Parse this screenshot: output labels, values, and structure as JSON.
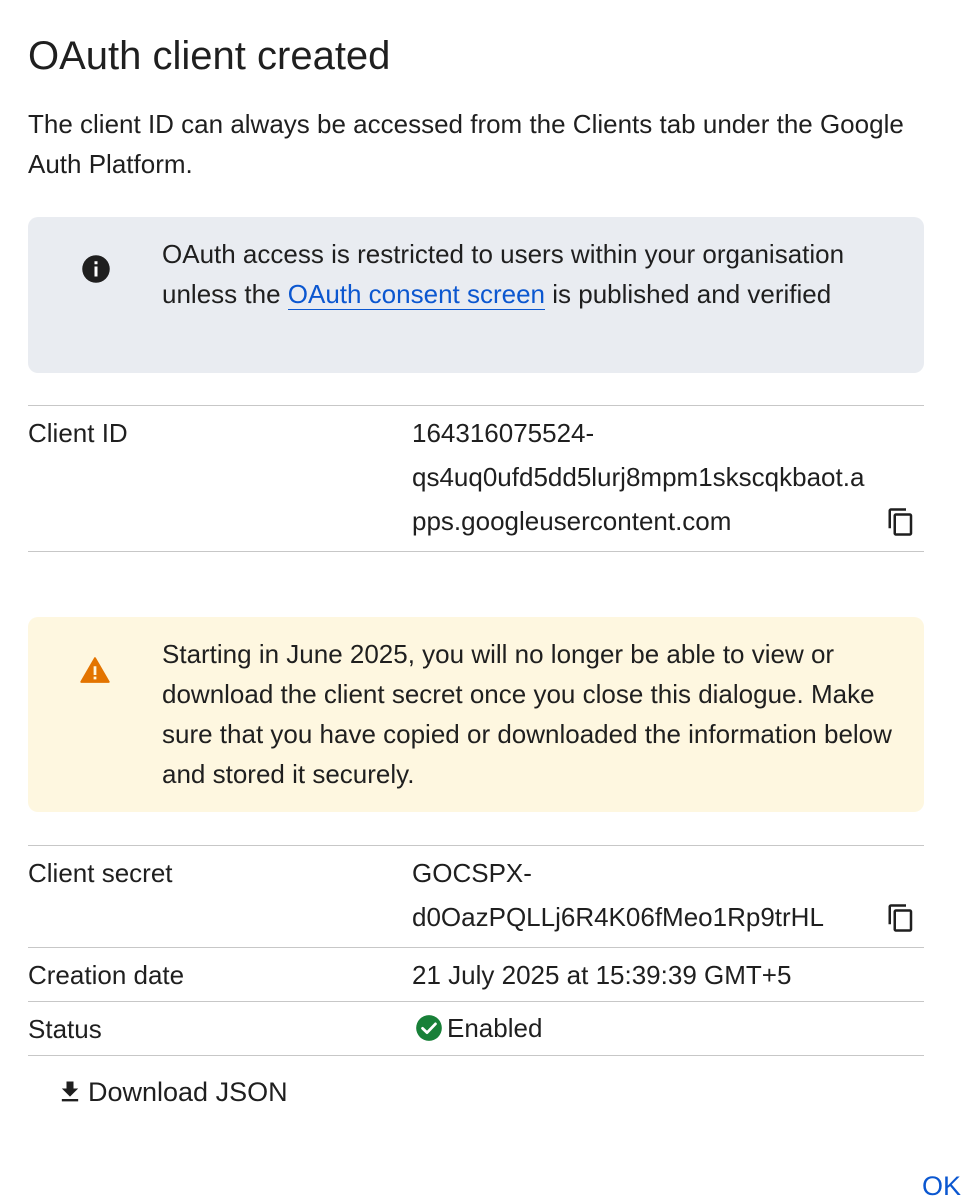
{
  "dialog": {
    "title": "OAuth client created",
    "description": "The client ID can always be accessed from the Clients tab under the Google Auth Platform."
  },
  "info_callout": {
    "icon": "info-icon",
    "text_before": "OAuth access is restricted to users within your organisation unless the ",
    "link_text": "OAuth consent screen",
    "text_after": " is published and verified"
  },
  "client_id": {
    "label": "Client ID",
    "value": "164316075524-qs4uq0ufd5dd5lurj8mpm1skscqkbaot.apps.googleusercontent.com",
    "value_lines": [
      "164316075524-",
      "qs4uq0ufd5dd5lurj8mpm1skscqkbaot.a",
      "pps.googleusercontent.com"
    ]
  },
  "warning_callout": {
    "icon": "warning-icon",
    "text": "Starting in June 2025, you will no longer be able to view or download the client secret once you close this dialogue. Make sure that you have copied or downloaded the information below and stored it securely."
  },
  "client_secret": {
    "label": "Client secret",
    "value_lines": [
      "GOCSPX-",
      "d0OazPQLLj6R4K06fMeo1Rp9trHL"
    ]
  },
  "creation_date": {
    "label": "Creation date",
    "value": "21 July 2025 at 15:39:39 GMT+5"
  },
  "status": {
    "label": "Status",
    "value": "Enabled",
    "icon": "check-circle-icon"
  },
  "actions": {
    "download_label": "Download JSON",
    "ok_label": "OK"
  },
  "colors": {
    "accent": "#0b57d0",
    "info_bg": "#e9ecf1",
    "warning_bg": "#fef7e0",
    "warning_icon": "#e37400",
    "success": "#188038"
  }
}
